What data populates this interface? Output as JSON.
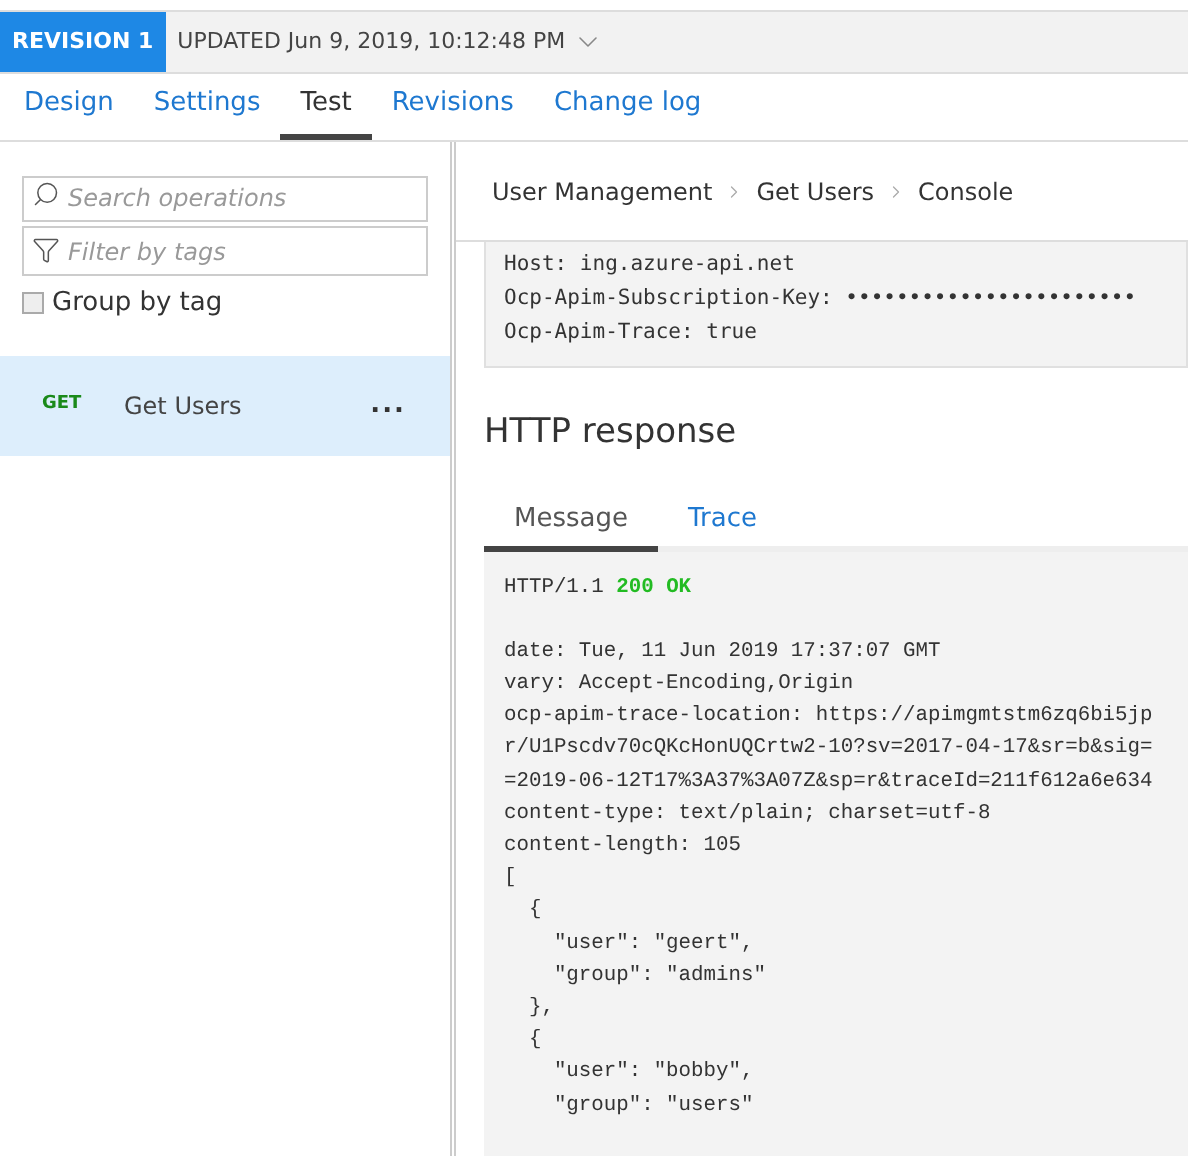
{
  "revision": {
    "badge": "REVISION 1",
    "updated": "UPDATED Jun 9, 2019, 10:12:48 PM"
  },
  "tabs": [
    {
      "label": "Design",
      "selected": false
    },
    {
      "label": "Settings",
      "selected": false
    },
    {
      "label": "Test",
      "selected": true
    },
    {
      "label": "Revisions",
      "selected": false
    },
    {
      "label": "Change log",
      "selected": false
    }
  ],
  "sidebar": {
    "search": {
      "placeholder": "Search operations"
    },
    "filter": {
      "placeholder": "Filter by tags"
    },
    "group_by_tag": {
      "label": "Group by tag",
      "checked": false
    },
    "operations": [
      {
        "method": "GET",
        "name": "Get Users",
        "more": "...",
        "selected": true
      }
    ]
  },
  "breadcrumb": [
    "User Management",
    "Get Users",
    "Console"
  ],
  "request_headers": [
    "Host: ing.azure-api.net",
    "Ocp-Apim-Subscription-Key: •••••••••••••••••••••••",
    "Ocp-Apim-Trace: true"
  ],
  "response": {
    "title": "HTTP response",
    "tabs": [
      {
        "label": "Message",
        "selected": true
      },
      {
        "label": "Trace",
        "selected": false
      }
    ],
    "status_line": {
      "protocol": "HTTP/1.1",
      "status": "200 OK"
    },
    "lines": [
      "date: Tue, 11 Jun 2019 17:37:07 GMT",
      "vary: Accept-Encoding,Origin",
      "ocp-apim-trace-location: https://apimgmtstm6zq6bi5jp",
      "r/U1Pscdv70cQKcHonUQCrtw2-10?sv=2017-04-17&sr=b&sig=",
      "=2019-06-12T17%3A37%3A07Z&sp=r&traceId=211f612a6e634",
      "content-type: text/plain; charset=utf-8",
      "content-length: 105",
      "[",
      "  {",
      "    \"user\": \"geert\",",
      "    \"group\": \"admins\"",
      "  },",
      "  {",
      "    \"user\": \"bobby\",",
      "    \"group\": \"users\""
    ]
  }
}
